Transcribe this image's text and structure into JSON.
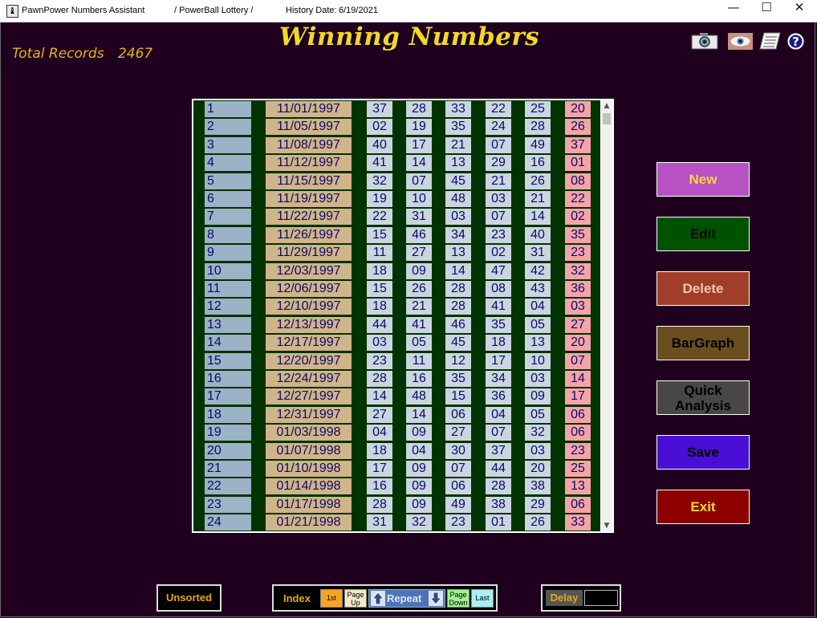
{
  "titlebar": {
    "app_name": "PawnPower Numbers Assistant",
    "game": "/ PowerBall Lottery /",
    "history_label": "History Date:",
    "history_date": "6/19/2021",
    "app_icon_glyph": "♝",
    "min_glyph": "—",
    "max_glyph": "☐",
    "close_glyph": "✕"
  },
  "header": {
    "title": "Winning Numbers",
    "total_label": "Total Records",
    "total_value": "2467"
  },
  "toolbar_icons": [
    "camera-icon",
    "eye-icon",
    "notepad-icon",
    "help-icon"
  ],
  "grid": {
    "rows": [
      {
        "idx": "1",
        "date": "11/01/1997",
        "n": [
          "37",
          "28",
          "33",
          "22",
          "25"
        ],
        "pb": "20"
      },
      {
        "idx": "2",
        "date": "11/05/1997",
        "n": [
          "02",
          "19",
          "35",
          "24",
          "28"
        ],
        "pb": "26"
      },
      {
        "idx": "3",
        "date": "11/08/1997",
        "n": [
          "40",
          "17",
          "21",
          "07",
          "49"
        ],
        "pb": "37"
      },
      {
        "idx": "4",
        "date": "11/12/1997",
        "n": [
          "41",
          "14",
          "13",
          "29",
          "16"
        ],
        "pb": "01"
      },
      {
        "idx": "5",
        "date": "11/15/1997",
        "n": [
          "32",
          "07",
          "45",
          "21",
          "26"
        ],
        "pb": "08"
      },
      {
        "idx": "6",
        "date": "11/19/1997",
        "n": [
          "19",
          "10",
          "48",
          "03",
          "21"
        ],
        "pb": "22"
      },
      {
        "idx": "7",
        "date": "11/22/1997",
        "n": [
          "22",
          "31",
          "03",
          "07",
          "14"
        ],
        "pb": "02"
      },
      {
        "idx": "8",
        "date": "11/26/1997",
        "n": [
          "15",
          "46",
          "34",
          "23",
          "40"
        ],
        "pb": "35"
      },
      {
        "idx": "9",
        "date": "11/29/1997",
        "n": [
          "11",
          "27",
          "13",
          "02",
          "31"
        ],
        "pb": "23"
      },
      {
        "idx": "10",
        "date": "12/03/1997",
        "n": [
          "18",
          "09",
          "14",
          "47",
          "42"
        ],
        "pb": "32"
      },
      {
        "idx": "11",
        "date": "12/06/1997",
        "n": [
          "15",
          "26",
          "28",
          "08",
          "43"
        ],
        "pb": "36"
      },
      {
        "idx": "12",
        "date": "12/10/1997",
        "n": [
          "18",
          "21",
          "28",
          "41",
          "04"
        ],
        "pb": "03"
      },
      {
        "idx": "13",
        "date": "12/13/1997",
        "n": [
          "44",
          "41",
          "46",
          "35",
          "05"
        ],
        "pb": "27"
      },
      {
        "idx": "14",
        "date": "12/17/1997",
        "n": [
          "03",
          "05",
          "45",
          "18",
          "13"
        ],
        "pb": "20"
      },
      {
        "idx": "15",
        "date": "12/20/1997",
        "n": [
          "23",
          "11",
          "12",
          "17",
          "10"
        ],
        "pb": "07"
      },
      {
        "idx": "16",
        "date": "12/24/1997",
        "n": [
          "28",
          "16",
          "35",
          "34",
          "03"
        ],
        "pb": "14"
      },
      {
        "idx": "17",
        "date": "12/27/1997",
        "n": [
          "14",
          "48",
          "15",
          "36",
          "09"
        ],
        "pb": "17"
      },
      {
        "idx": "18",
        "date": "12/31/1997",
        "n": [
          "27",
          "14",
          "06",
          "04",
          "05"
        ],
        "pb": "06"
      },
      {
        "idx": "19",
        "date": "01/03/1998",
        "n": [
          "04",
          "09",
          "27",
          "07",
          "32"
        ],
        "pb": "06"
      },
      {
        "idx": "20",
        "date": "01/07/1998",
        "n": [
          "18",
          "04",
          "30",
          "37",
          "03"
        ],
        "pb": "23"
      },
      {
        "idx": "21",
        "date": "01/10/1998",
        "n": [
          "17",
          "09",
          "07",
          "44",
          "20"
        ],
        "pb": "25"
      },
      {
        "idx": "22",
        "date": "01/14/1998",
        "n": [
          "16",
          "09",
          "06",
          "28",
          "38"
        ],
        "pb": "13"
      },
      {
        "idx": "23",
        "date": "01/17/1998",
        "n": [
          "28",
          "09",
          "49",
          "38",
          "29"
        ],
        "pb": "06"
      },
      {
        "idx": "24",
        "date": "01/21/1998",
        "n": [
          "31",
          "32",
          "23",
          "01",
          "26"
        ],
        "pb": "33"
      }
    ]
  },
  "buttons": {
    "new": "New",
    "edit": "Edit",
    "delete": "Delete",
    "bargraph": "BarGraph",
    "quick_line1": "Quick",
    "quick_line2": "Analysis",
    "save": "Save",
    "exit": "Exit"
  },
  "button_colors": {
    "new": "#b752c4",
    "edit": "#005200",
    "delete": "#a03e2a",
    "bargraph": "#6a4e20",
    "quick": "#474747",
    "save": "#4a0ed6",
    "exit": "#8c0000"
  },
  "bottom": {
    "unsorted": "Unsorted",
    "index_label": "Index",
    "first": "1st",
    "page_up_1": "Page",
    "page_up_2": "Up",
    "repeat": "Repeat",
    "page_down_1": "Page",
    "page_down_2": "Down",
    "last": "Last",
    "delay": "Delay"
  }
}
